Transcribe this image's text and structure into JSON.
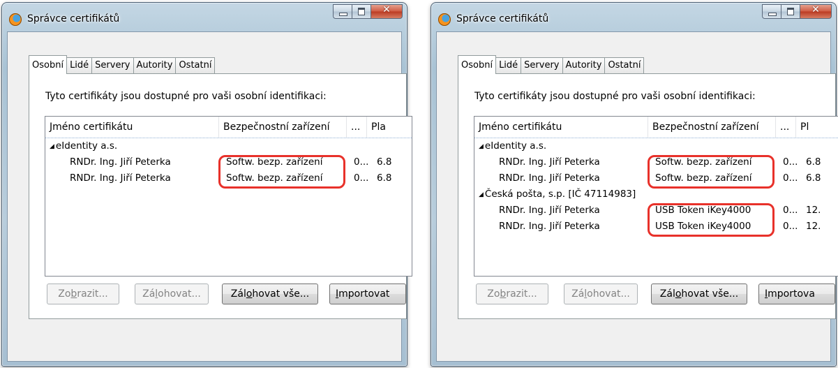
{
  "windows": [
    {
      "title": "Správce certifikátů",
      "tabs": [
        "Osobní",
        "Lidé",
        "Servery",
        "Autority",
        "Ostatní"
      ],
      "intro": "Tyto certifikáty jsou dostupné pro vaši osobní identifikaci:",
      "columns": [
        "Jméno certifikátu",
        "Bezpečnostní zařízení",
        "...",
        "Pla"
      ],
      "groups": [
        {
          "name": "eIdentity a.s.",
          "rows": [
            {
              "name": "RNDr. Ing. Jiří Peterka",
              "device": "Softw. bezp. zařízení",
              "col3": "0...",
              "col4": "6.8"
            },
            {
              "name": "RNDr. Ing. Jiří Peterka",
              "device": "Softw. bezp. zařízení",
              "col3": "0...",
              "col4": "6.8"
            }
          ]
        }
      ],
      "buttons": {
        "view": {
          "pre": "Zo",
          "key": "b",
          "post": "razit..."
        },
        "backup": {
          "pre": "Zá",
          "key": "l",
          "post": "ohovat..."
        },
        "backup_all": {
          "pre": "Zál",
          "key": "o",
          "post": "hovat vše..."
        },
        "import": {
          "pre": "",
          "key": "I",
          "post": "mportovat"
        }
      }
    },
    {
      "title": "Správce certifikátů",
      "tabs": [
        "Osobní",
        "Lidé",
        "Servery",
        "Autority",
        "Ostatní"
      ],
      "intro": "Tyto certifikáty jsou dostupné pro vaši osobní identifikaci:",
      "columns": [
        "Jméno certifikátu",
        "Bezpečnostní zařízení",
        "...",
        "Pl"
      ],
      "groups": [
        {
          "name": "eIdentity a.s.",
          "rows": [
            {
              "name": "RNDr. Ing. Jiří Peterka",
              "device": "Softw. bezp. zařízení",
              "col3": "0...",
              "col4": "6.8"
            },
            {
              "name": "RNDr. Ing. Jiří Peterka",
              "device": "Softw. bezp. zařízení",
              "col3": "0...",
              "col4": "6.8"
            }
          ]
        },
        {
          "name": "Česká pošta, s.p. [IČ 47114983]",
          "rows": [
            {
              "name": "RNDr. Ing. Jiří Peterka",
              "device": "USB Token iKey4000",
              "col3": "0...",
              "col4": "12."
            },
            {
              "name": "RNDr. Ing. Jiří Peterka",
              "device": "USB Token iKey4000",
              "col3": "0...",
              "col4": "12."
            }
          ]
        }
      ],
      "buttons": {
        "view": {
          "pre": "Zo",
          "key": "b",
          "post": "razit..."
        },
        "backup": {
          "pre": "Zá",
          "key": "l",
          "post": "ohovat..."
        },
        "backup_all": {
          "pre": "Zál",
          "key": "o",
          "post": "hovat vše..."
        },
        "import": {
          "pre": "",
          "key": "I",
          "post": "mportova"
        }
      }
    }
  ],
  "colors": {
    "highlight": "#e8312a",
    "window_frame": "#b8cddc",
    "close_button": "#cf5a42"
  },
  "icons": [
    "firefox-icon",
    "minimize-icon",
    "maximize-icon",
    "close-icon",
    "collapse-triangle-icon"
  ]
}
